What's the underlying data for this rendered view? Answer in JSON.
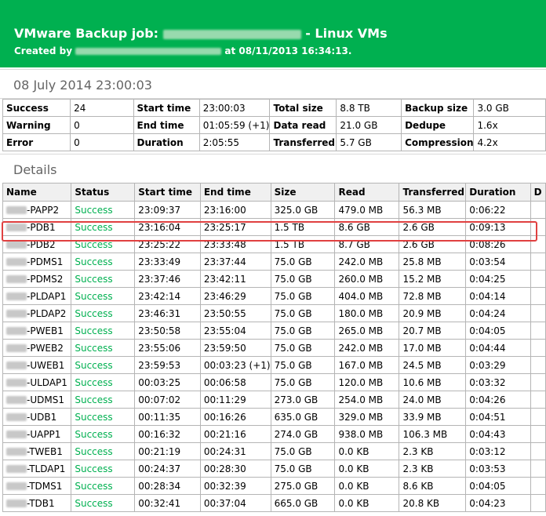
{
  "header": {
    "title_prefix": "VMware Backup job:",
    "title_suffix": "- Linux VMs",
    "created_prefix": "Created by",
    "created_suffix": "at 08/11/2013 16:34:13.",
    "color": "#00b050"
  },
  "session": {
    "title": "08 July 2014 23:00:03"
  },
  "summary": {
    "rows": [
      [
        "Success",
        "24",
        "Start time",
        "23:00:03",
        "Total size",
        "8.8 TB",
        "Backup size",
        "3.0 GB"
      ],
      [
        "Warning",
        "0",
        "End time",
        "01:05:59 (+1)",
        "Data read",
        "21.0 GB",
        "Dedupe",
        "1.6x"
      ],
      [
        "Error",
        "0",
        "Duration",
        "2:05:55",
        "Transferred",
        "5.7 GB",
        "Compression",
        "4.2x"
      ]
    ]
  },
  "details": {
    "title": "Details",
    "columns": [
      "Name",
      "Status",
      "Start time",
      "End time",
      "Size",
      "Read",
      "Transferred",
      "Duration",
      "D"
    ],
    "rows": [
      [
        "-PAPP2",
        "Success",
        "23:09:37",
        "23:16:00",
        "325.0 GB",
        "479.0 MB",
        "56.3 MB",
        "0:06:22"
      ],
      [
        "-PDB1",
        "Success",
        "23:16:04",
        "23:25:17",
        "1.5 TB",
        "8.6 GB",
        "2.6 GB",
        "0:09:13"
      ],
      [
        "-PDB2",
        "Success",
        "23:25:22",
        "23:33:48",
        "1.5 TB",
        "8.7 GB",
        "2.6 GB",
        "0:08:26"
      ],
      [
        "-PDMS1",
        "Success",
        "23:33:49",
        "23:37:44",
        "75.0 GB",
        "242.0 MB",
        "25.8 MB",
        "0:03:54"
      ],
      [
        "-PDMS2",
        "Success",
        "23:37:46",
        "23:42:11",
        "75.0 GB",
        "260.0 MB",
        "15.2 MB",
        "0:04:25"
      ],
      [
        "-PLDAP1",
        "Success",
        "23:42:14",
        "23:46:29",
        "75.0 GB",
        "404.0 MB",
        "72.8 MB",
        "0:04:14"
      ],
      [
        "-PLDAP2",
        "Success",
        "23:46:31",
        "23:50:55",
        "75.0 GB",
        "180.0 MB",
        "20.9 MB",
        "0:04:24"
      ],
      [
        "-PWEB1",
        "Success",
        "23:50:58",
        "23:55:04",
        "75.0 GB",
        "265.0 MB",
        "20.7 MB",
        "0:04:05"
      ],
      [
        "-PWEB2",
        "Success",
        "23:55:06",
        "23:59:50",
        "75.0 GB",
        "242.0 MB",
        "17.0 MB",
        "0:04:44"
      ],
      [
        "-UWEB1",
        "Success",
        "23:59:53",
        "00:03:23 (+1)",
        "75.0 GB",
        "167.0 MB",
        "24.5 MB",
        "0:03:29"
      ],
      [
        "-ULDAP1",
        "Success",
        "00:03:25",
        "00:06:58",
        "75.0 GB",
        "120.0 MB",
        "10.6 MB",
        "0:03:32"
      ],
      [
        "-UDMS1",
        "Success",
        "00:07:02",
        "00:11:29",
        "273.0 GB",
        "254.0 MB",
        "24.0 MB",
        "0:04:26"
      ],
      [
        "-UDB1",
        "Success",
        "00:11:35",
        "00:16:26",
        "635.0 GB",
        "329.0 MB",
        "33.9 MB",
        "0:04:51"
      ],
      [
        "-UAPP1",
        "Success",
        "00:16:32",
        "00:21:16",
        "274.0 GB",
        "938.0 MB",
        "106.3 MB",
        "0:04:43"
      ],
      [
        "-TWEB1",
        "Success",
        "00:21:19",
        "00:24:31",
        "75.0 GB",
        "0.0 KB",
        "2.3 KB",
        "0:03:12"
      ],
      [
        "-TLDAP1",
        "Success",
        "00:24:37",
        "00:28:30",
        "75.0 GB",
        "0.0 KB",
        "2.3 KB",
        "0:03:53"
      ],
      [
        "-TDMS1",
        "Success",
        "00:28:34",
        "00:32:39",
        "275.0 GB",
        "0.0 KB",
        "8.6 KB",
        "0:04:05"
      ],
      [
        "-TDB1",
        "Success",
        "00:32:41",
        "00:37:04",
        "665.0 GB",
        "0.0 KB",
        "20.8 KB",
        "0:04:23"
      ]
    ],
    "highlighted_row": 1,
    "highlight_color": "#e04040",
    "success_color": "#00b050"
  }
}
